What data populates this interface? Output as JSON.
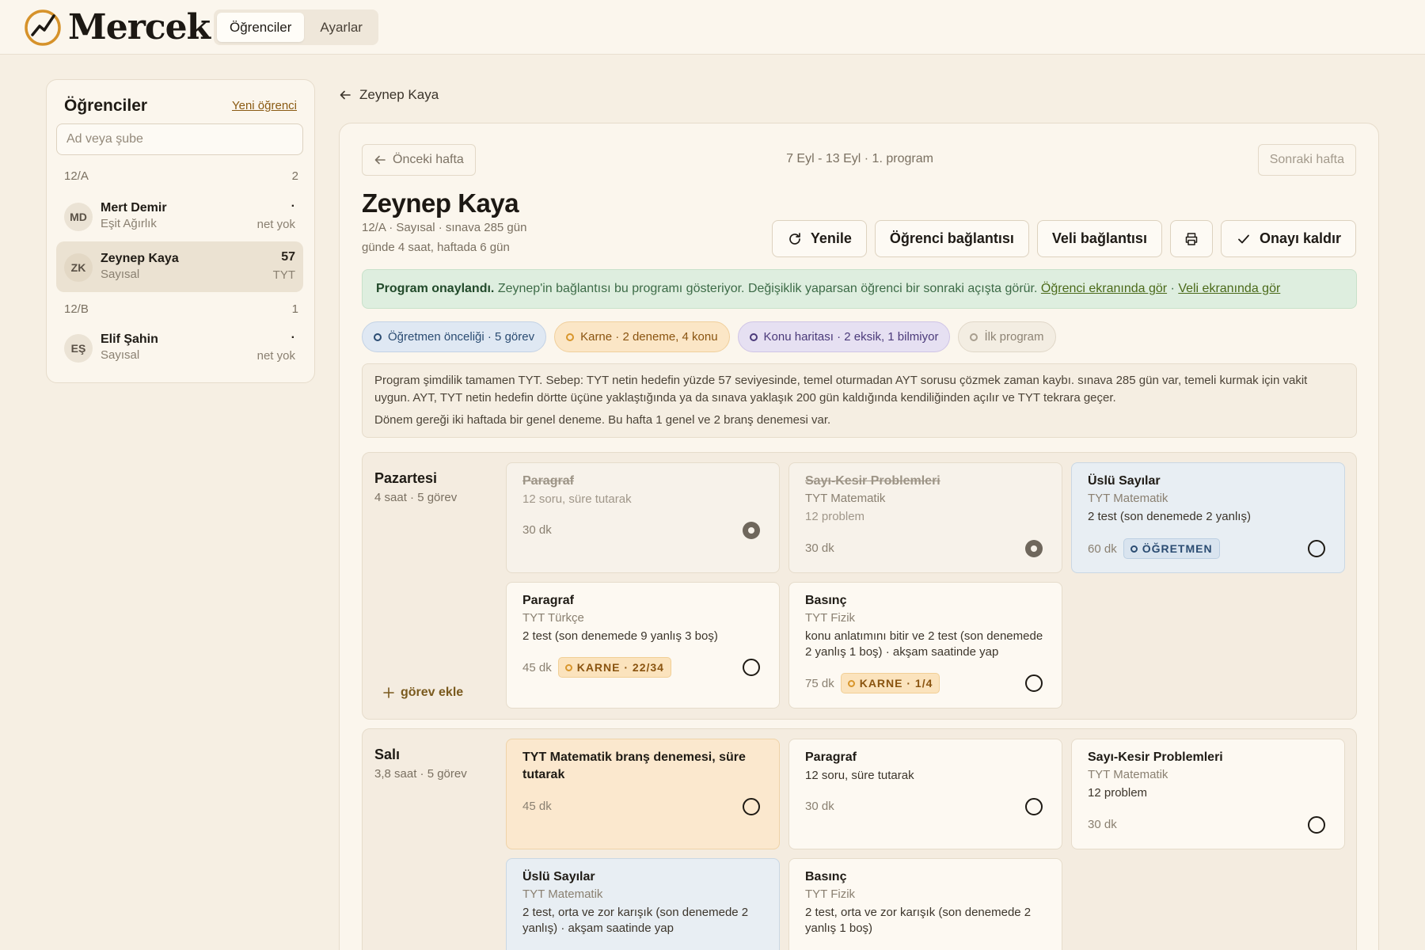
{
  "app": {
    "logo_text": "Mercek",
    "nav_tabs": [
      {
        "label": "Öğrenciler",
        "active": true
      },
      {
        "label": "Ayarlar",
        "active": false
      }
    ],
    "accent_color": "#d6922a"
  },
  "sidebar": {
    "title": "Öğrenciler",
    "new_student": "Yeni öğrenci",
    "search_placeholder": "Ad veya şube",
    "groups": [
      {
        "name": "12/A",
        "count": "2",
        "students": [
          {
            "initials": "MD",
            "name": "Mert Demir",
            "track": "Eşit Ağırlık",
            "value": "·",
            "unit": "net yok",
            "active": false
          },
          {
            "initials": "ZK",
            "name": "Zeynep Kaya",
            "track": "Sayısal",
            "value": "57",
            "unit": "TYT",
            "active": true
          }
        ]
      },
      {
        "name": "12/B",
        "count": "1",
        "students": [
          {
            "initials": "EŞ",
            "name": "Elif Şahin",
            "track": "Sayısal",
            "value": "·",
            "unit": "net yok",
            "active": false
          }
        ]
      }
    ]
  },
  "main": {
    "back_label": "Zeynep Kaya",
    "prev_week": "Önceki hafta",
    "next_week": "Sonraki hafta",
    "week_label": "7 Eyl - 13 Eyl · 1. program",
    "student_name": "Zeynep Kaya",
    "meta_line1": "12/A · Sayısal · sınava 285 gün",
    "meta_line2": "günde 4 saat, haftada 6 gün",
    "actions": {
      "refresh": "Yenile",
      "student_link": "Öğrenci bağlantısı",
      "parent_link": "Veli bağlantısı",
      "unapprove": "Onayı kaldır"
    },
    "notice": {
      "bold": "Program onaylandı.",
      "text": " Zeynep'in bağlantısı bu programı gösteriyor. Değişiklik yaparsan öğrenci bir sonraki açışta görür. ",
      "link_student": "Öğrenci ekranında gör",
      "sep": " · ",
      "link_parent": "Veli ekranında gör"
    },
    "chips": {
      "teacher": "Öğretmen önceliği · 5 görev",
      "report": "Karne · 2 deneme, 4 konu",
      "topic_map": "Konu haritası · 2 eksik, 1 bilmiyor",
      "first": "İlk program"
    },
    "explanation": {
      "p1": "Program şimdilik tamamen TYT. Sebep: TYT netin hedefin yüzde 57 seviyesinde, temel oturmadan AYT sorusu çözmek zaman kaybı. sınava 285 gün var, temeli kurmak için vakit uygun. AYT, TYT netin hedefin dörtte üçüne yaklaştığında ya da sınava yaklaşık 200 gün kaldığında kendiliğinden açılır ve TYT tekrara geçer.",
      "p2": "Dönem gereği iki haftada bir genel deneme. Bu hafta 1 genel ve 2 branş denemesi var."
    },
    "add_task": "görev ekle",
    "days": [
      {
        "name": "Pazartesi",
        "meta": "4 saat · 5 görev",
        "tasks": [
          {
            "title": "Paragraf",
            "subject": "",
            "desc": "12 soru, süre tutarak",
            "time": "30 dk",
            "badge": "",
            "done": true
          },
          {
            "title": "Sayı-Kesir Problemleri",
            "subject": "TYT Matematik",
            "desc": "12 problem",
            "time": "30 dk",
            "badge": "",
            "done": true
          },
          {
            "title": "Üslü Sayılar",
            "subject": "TYT Matematik",
            "desc": "2 test (son denemede 2 yanlış)",
            "time": "60 dk",
            "badge": "ÖĞRETMEN",
            "done": false
          },
          {
            "title": "Paragraf",
            "subject": "TYT Türkçe",
            "desc": "2 test (son denemede 9 yanlış 3 boş)",
            "time": "45 dk",
            "badge": "KARNE · 22/34",
            "done": false
          },
          {
            "title": "Basınç",
            "subject": "TYT Fizik",
            "desc": "konu anlatımını bitir ve 2 test (son denemede 2 yanlış 1 boş) · akşam saatinde yap",
            "time": "75 dk",
            "badge": "KARNE · 1/4",
            "done": false
          }
        ]
      },
      {
        "name": "Salı",
        "meta": "3,8 saat · 5 görev",
        "tasks": [
          {
            "title": "TYT Matematik branş denemesi, süre tutarak",
            "subject": "",
            "desc": "",
            "time": "45 dk",
            "badge": "",
            "done": false
          },
          {
            "title": "Paragraf",
            "subject": "",
            "desc": "12 soru, süre tutarak",
            "time": "30 dk",
            "badge": "",
            "done": false
          },
          {
            "title": "Sayı-Kesir Problemleri",
            "subject": "TYT Matematik",
            "desc": "12 problem",
            "time": "30 dk",
            "badge": "",
            "done": false
          },
          {
            "title": "Üslü Sayılar",
            "subject": "TYT Matematik",
            "desc": "2 test, orta ve zor karışık (son denemede 2 yanlış) · akşam saatinde yap",
            "time": "",
            "badge": "",
            "done": false
          },
          {
            "title": "Basınç",
            "subject": "TYT Fizik",
            "desc": "2 test, orta ve zor karışık (son denemede 2 yanlış 1 boş)",
            "time": "",
            "badge": "",
            "done": false
          }
        ]
      }
    ]
  }
}
